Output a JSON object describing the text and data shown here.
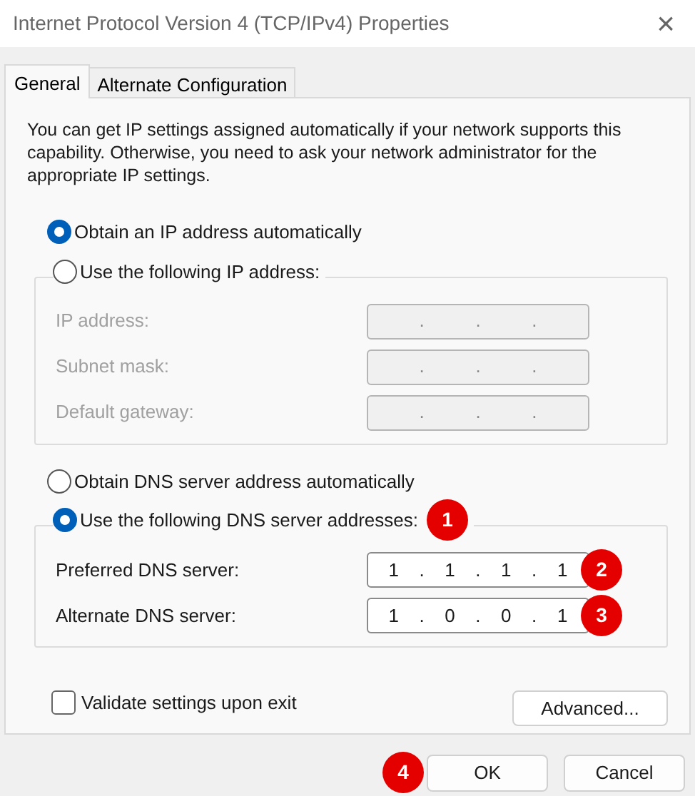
{
  "window": {
    "title": "Internet Protocol Version 4 (TCP/IPv4) Properties",
    "close": "×"
  },
  "tabs": [
    {
      "label": "General",
      "selected": true
    },
    {
      "label": "Alternate Configuration",
      "selected": false
    }
  ],
  "intro": "You can get IP settings assigned automatically if your network supports this capability. Otherwise, you need to ask your network administrator for the appropriate IP settings.",
  "ip_options": [
    {
      "label": "Obtain an IP address automatically",
      "selected": true
    },
    {
      "label": "Use the following IP address:",
      "selected": false
    }
  ],
  "ip_group": {
    "disabled": true,
    "fields": [
      {
        "label": "IP address:",
        "segments": [
          ".",
          ".",
          "."
        ]
      },
      {
        "label": "Subnet mask:",
        "segments": [
          ".",
          ".",
          "."
        ]
      },
      {
        "label": "Default gateway:",
        "segments": [
          ".",
          ".",
          "."
        ]
      }
    ]
  },
  "dns_options": [
    {
      "label": "Obtain DNS server address automatically",
      "selected": false
    },
    {
      "label": "Use the following DNS server addresses:",
      "selected": true,
      "badge": "1"
    }
  ],
  "dns_group": {
    "disabled": false,
    "fields": [
      {
        "label": "Preferred DNS server:",
        "segments": [
          "1",
          ".",
          "1",
          ".",
          "1",
          ".",
          "1"
        ],
        "badge": "2"
      },
      {
        "label": "Alternate DNS server:",
        "segments": [
          "1",
          ".",
          "0",
          ".",
          "0",
          ".",
          "1"
        ],
        "badge": "3"
      }
    ]
  },
  "validate": {
    "label": "Validate settings upon exit",
    "checked": false
  },
  "advanced_button": "Advanced...",
  "buttons": [
    {
      "label": "OK",
      "badge": "4"
    },
    {
      "label": "Cancel"
    }
  ]
}
